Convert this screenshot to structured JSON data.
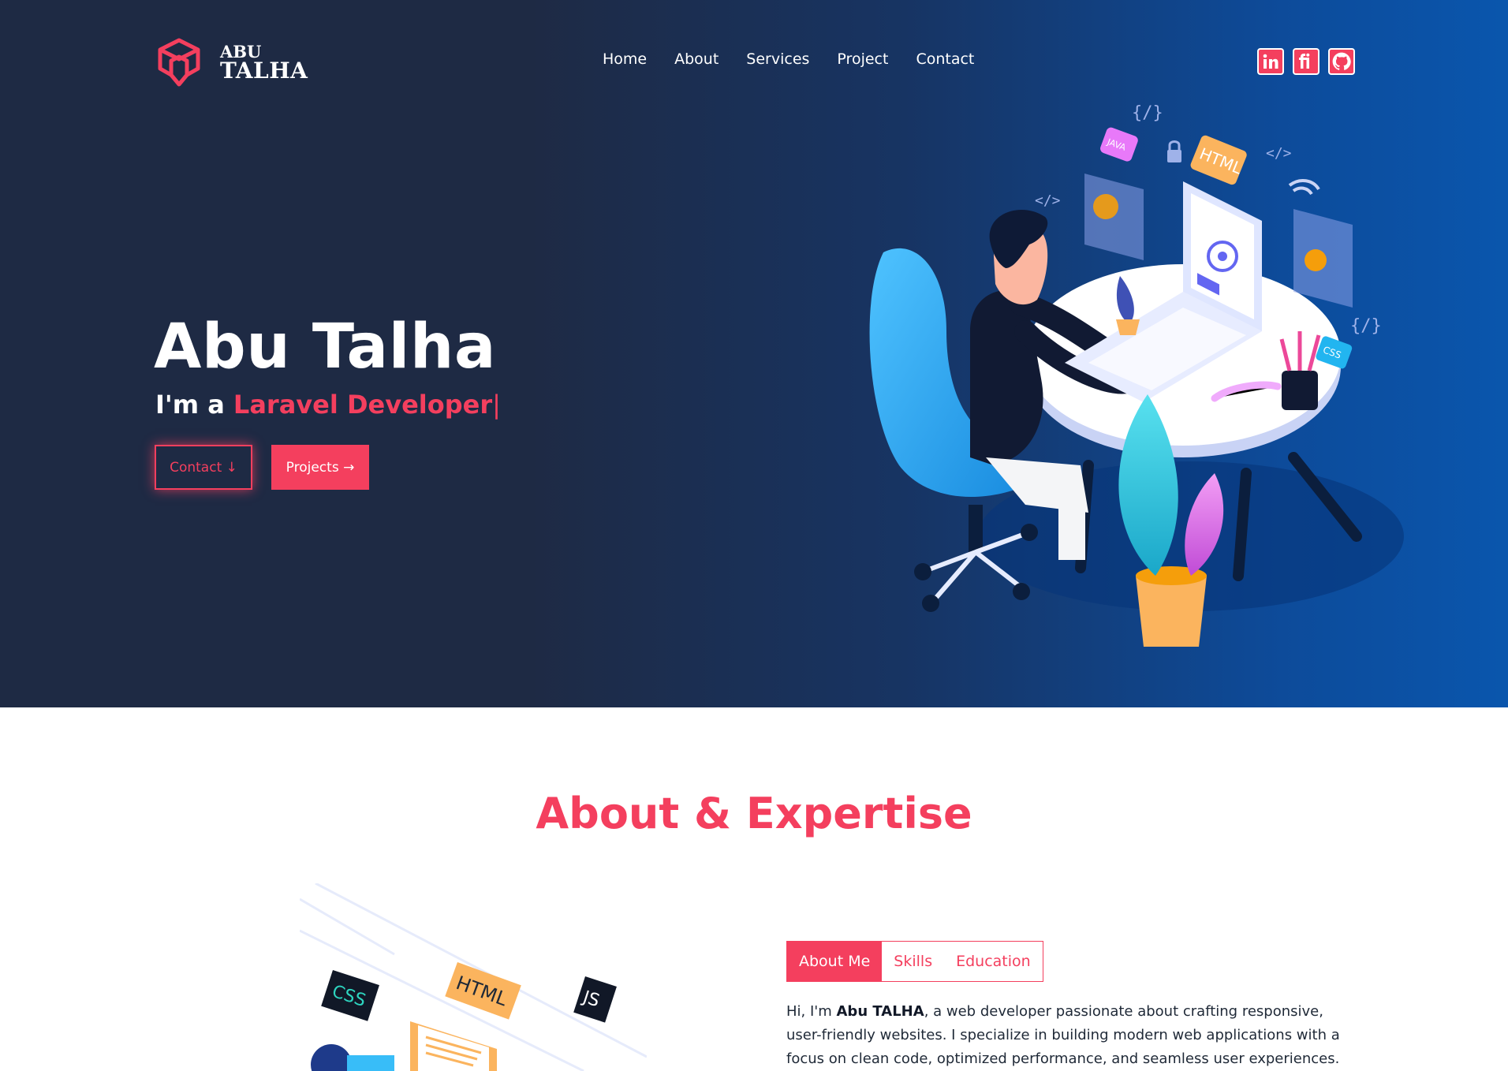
{
  "brand": {
    "line1": "ABU",
    "line2": "TALHA"
  },
  "nav": {
    "items": [
      "Home",
      "About",
      "Services",
      "Project",
      "Contact"
    ]
  },
  "socials": [
    {
      "label": "in",
      "icon": "linkedin-icon"
    },
    {
      "label": "fi",
      "icon": "fiverr-icon"
    },
    {
      "label": "",
      "icon": "github-icon"
    }
  ],
  "hero": {
    "name": "Abu Talha",
    "intro_prefix": "I'm a ",
    "role": "Laravel Developer",
    "caret": "|",
    "contact_label": "Contact ↓",
    "projects_label": "Projects →"
  },
  "illustration_labels": {
    "java": "JAVA",
    "html": "HTML",
    "css": "CSS"
  },
  "about": {
    "title": "About & Expertise",
    "tabs": [
      {
        "label": "About Me",
        "active": true
      },
      {
        "label": "Skills",
        "active": false
      },
      {
        "label": "Education",
        "active": false
      }
    ],
    "text_prefix": "Hi, I'm ",
    "text_name": "Abu TALHA",
    "text_body": ", a web developer passionate about crafting responsive, user-friendly websites. I specialize in building modern web applications with a focus on clean code, optimized performance, and seamless user experiences. With a deep",
    "illus_labels": {
      "css": "CSS",
      "html": "HTML",
      "js": "JS"
    }
  },
  "colors": {
    "accent": "#f43f5e",
    "hero_dark": "#1e2a44",
    "hero_blue": "#0a56ad"
  }
}
